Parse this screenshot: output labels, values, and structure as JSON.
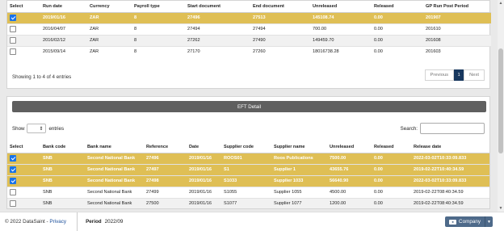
{
  "top_table": {
    "headers": [
      "Select",
      "Run date",
      "Currency",
      "Payroll type",
      "Start document",
      "End document",
      "Unreleased",
      "Released",
      "GP Run Post Period"
    ],
    "rows": [
      {
        "selected": true,
        "cells": [
          "2019/01/16",
          "ZAR",
          "8",
          "27496",
          "27513",
          "145108.74",
          "0.00",
          "201907"
        ]
      },
      {
        "selected": false,
        "cells": [
          "2016/04/07",
          "ZAR",
          "8",
          "27494",
          "27494",
          "700.00",
          "0.00",
          "201610"
        ]
      },
      {
        "selected": false,
        "cells": [
          "2016/02/12",
          "ZAR",
          "8",
          "27262",
          "27490",
          "149459.70",
          "0.00",
          "201608"
        ]
      },
      {
        "selected": false,
        "cells": [
          "2015/09/14",
          "ZAR",
          "8",
          "27170",
          "27260",
          "18016738.28",
          "0.00",
          "201603"
        ]
      }
    ],
    "info": "Showing 1 to 4 of 4 entries",
    "pagination": {
      "previous": "Previous",
      "current": "1",
      "next": "Next"
    }
  },
  "eft": {
    "title": "EFT Detail",
    "show_label": "Show",
    "entries_label": "entries",
    "search_label": "Search:",
    "headers": [
      "Select",
      "Bank code",
      "Bank name",
      "Reference",
      "Date",
      "Supplier code",
      "Supplier name",
      "Unreleased",
      "Released",
      "Release date"
    ],
    "rows": [
      {
        "selected": true,
        "cells": [
          "SNB",
          "Second National Bank",
          "27496",
          "2019/01/16",
          "ROOS01",
          "Roos Publications",
          "7500.00",
          "0.00",
          "2022-03-02T10:33:09.833"
        ]
      },
      {
        "selected": true,
        "cells": [
          "SNB",
          "Second National Bank",
          "27497",
          "2019/01/16",
          "S1",
          "Supplier 1",
          "43655.76",
          "0.00",
          "2019-02-22T10:40:34.59"
        ]
      },
      {
        "selected": true,
        "cells": [
          "SNB",
          "Second National Bank",
          "27498",
          "2019/01/16",
          "S1033",
          "Supplier 1033",
          "56640.90",
          "0.00",
          "2022-03-02T10:33:09.833"
        ]
      },
      {
        "selected": false,
        "cells": [
          "SNB",
          "Second National Bank",
          "27499",
          "2019/01/16",
          "S1055",
          "Supplier 1055",
          "4500.00",
          "0.00",
          "2019-02-22T08:40:34.59"
        ]
      },
      {
        "selected": false,
        "cells": [
          "SNB",
          "Second National Bank",
          "27500",
          "2019/01/16",
          "S1077",
          "Supplier 1077",
          "1200.00",
          "0.00",
          "2019-02-22T08:40:34.59"
        ]
      }
    ]
  },
  "footer": {
    "copyright": "© 2022 DataSaint - ",
    "privacy": "Privacy",
    "period_label": "Period",
    "period_value": "2022/09",
    "company_label": "Company",
    "company_icon": "briefcase-icon"
  },
  "colors": {
    "selected_row": "#dfbf55",
    "checkbox": "#1a73e8",
    "active_page": "#17375e",
    "eft_bar": "#5f5f5f"
  }
}
